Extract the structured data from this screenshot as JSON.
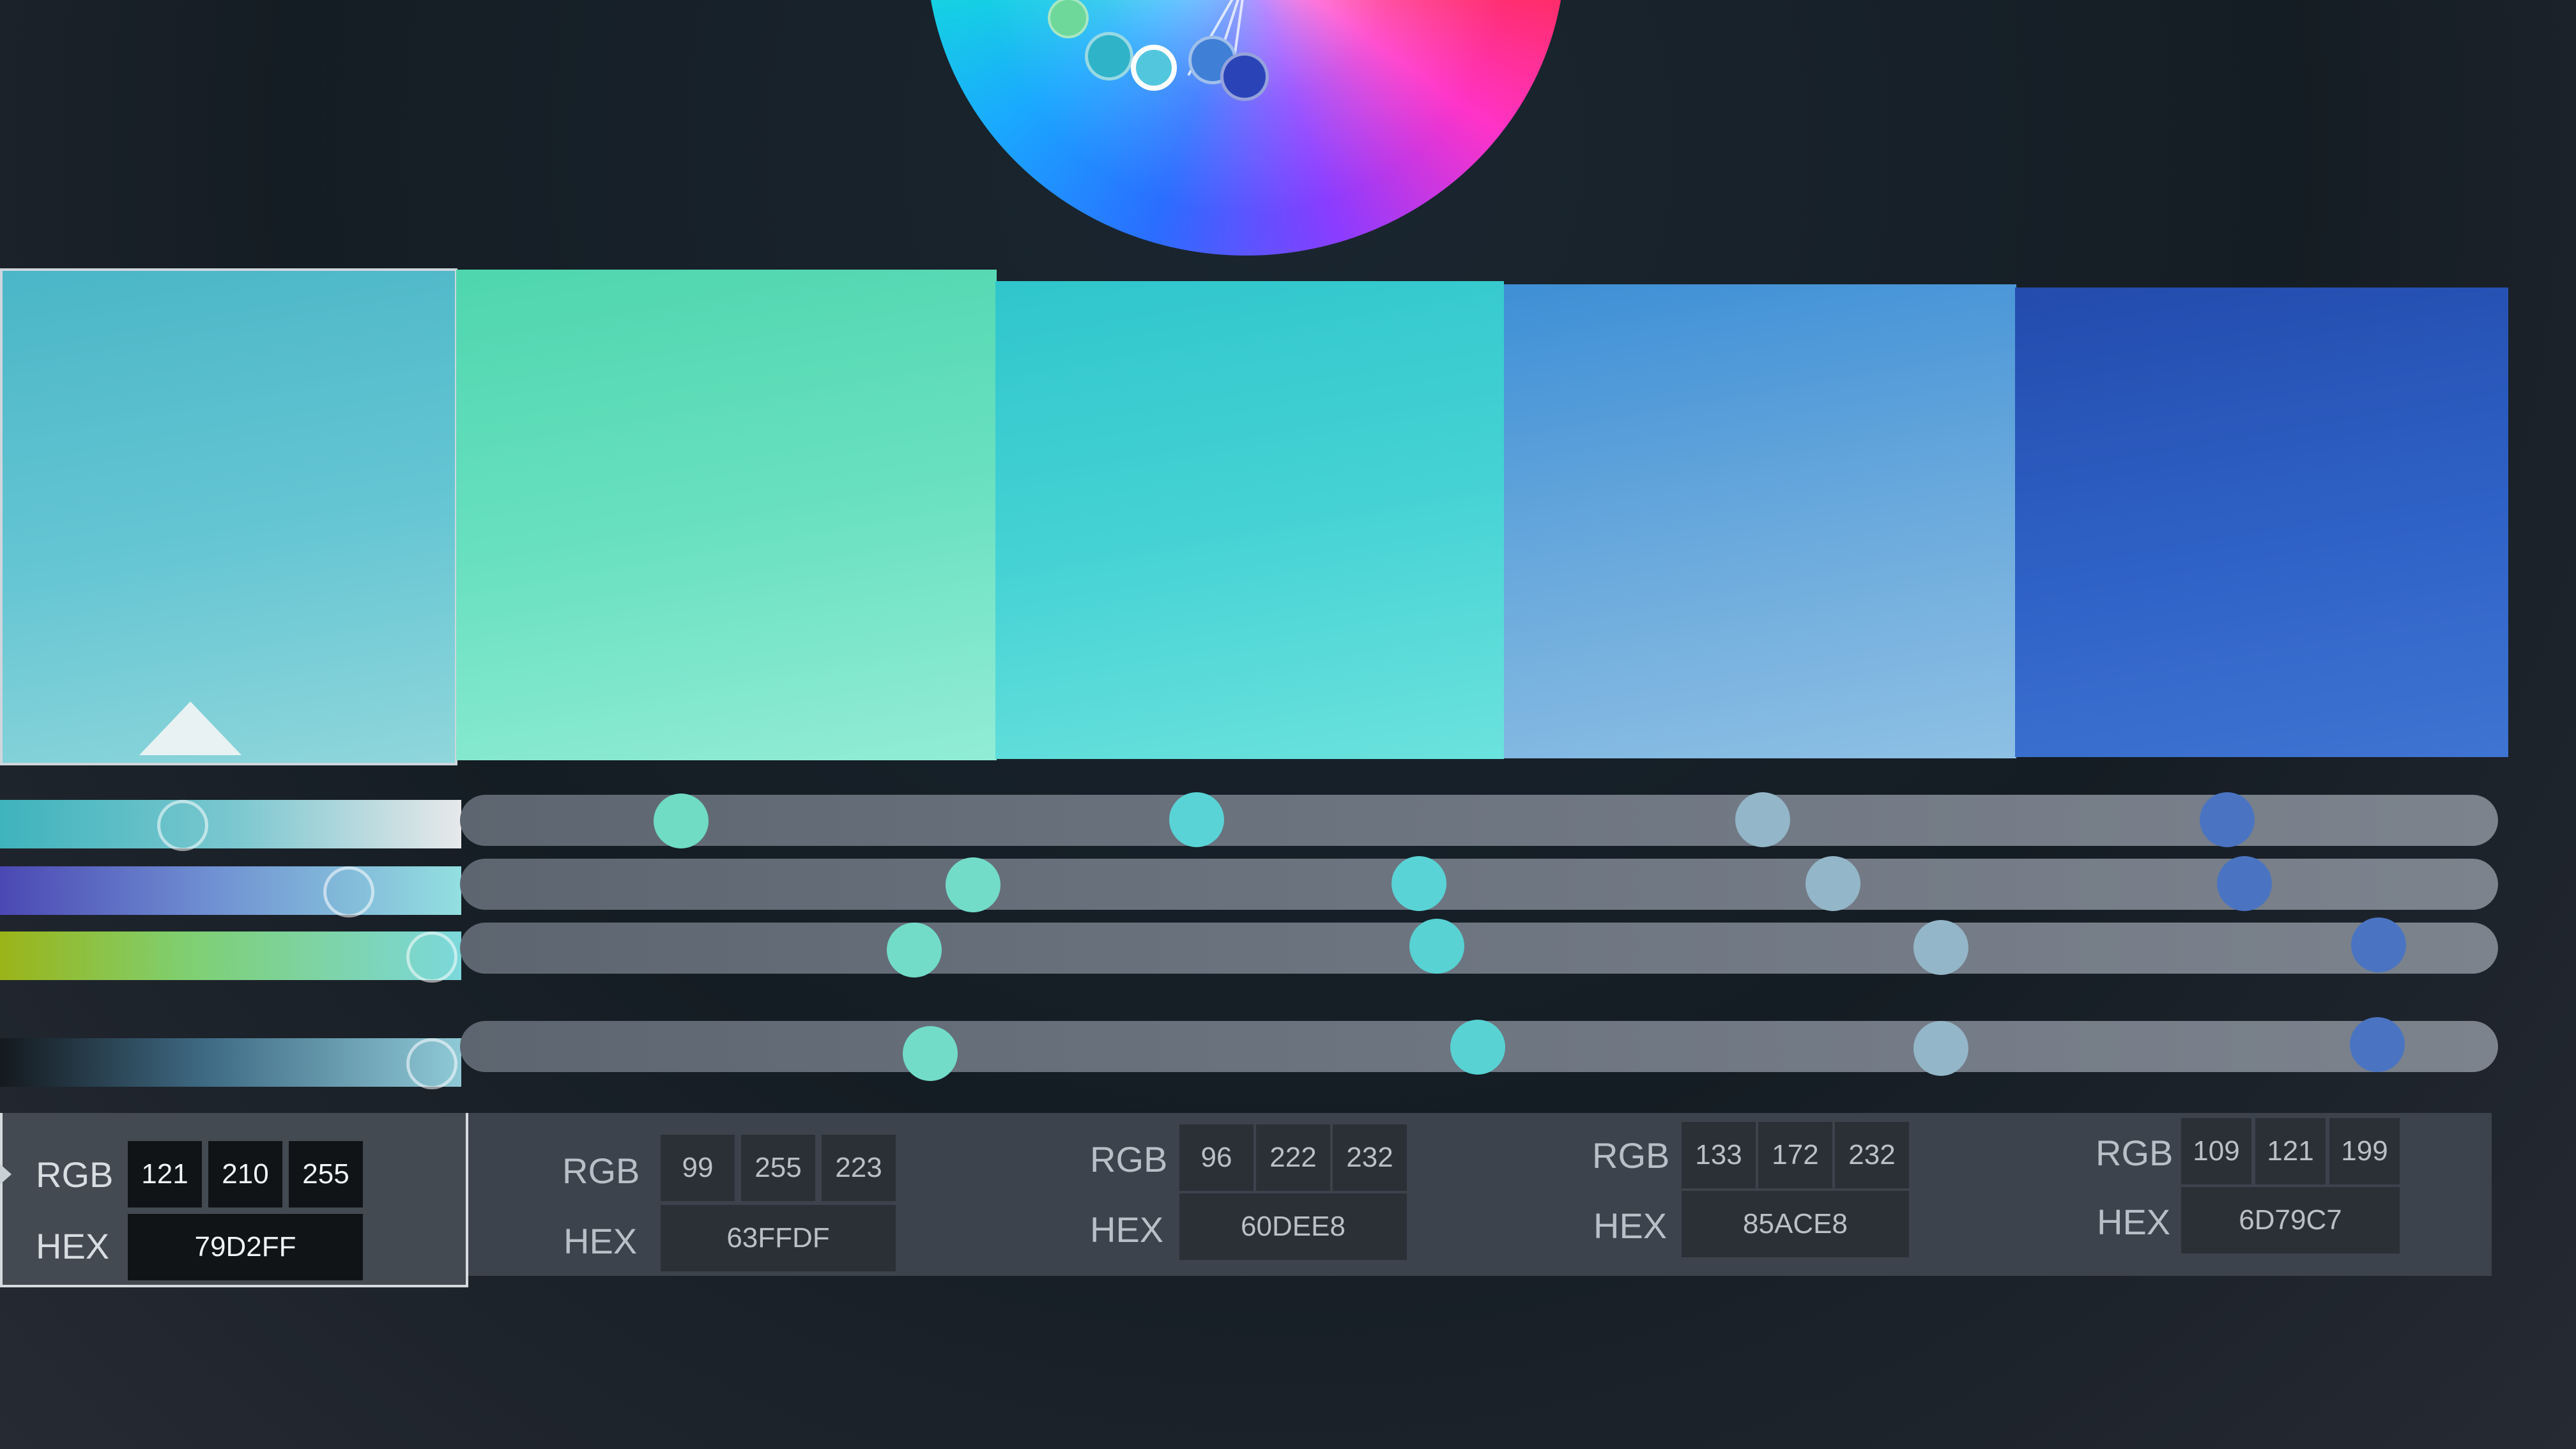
{
  "colors": {
    "swatch1": "#79D2FF",
    "swatch2": "#63FFDF",
    "swatch3": "#60DEE8",
    "swatch4": "#85ACE8",
    "swatch5": "#6D79C7"
  },
  "swatches": [
    {
      "rgb": [
        "121",
        "210",
        "255"
      ],
      "hex": "79D2FF",
      "active": true
    },
    {
      "rgb": [
        "99",
        "255",
        "223"
      ],
      "hex": "63FFDF",
      "active": false
    },
    {
      "rgb": [
        "96",
        "222",
        "232"
      ],
      "hex": "60DEE8",
      "active": false
    },
    {
      "rgb": [
        "133",
        "172",
        "232"
      ],
      "hex": "85ACE8",
      "active": false
    },
    {
      "rgb": [
        "109",
        "121",
        "199"
      ],
      "hex": "6D79C7",
      "active": false
    }
  ],
  "labels": {
    "rgb": "RGB",
    "hex": "HEX"
  }
}
